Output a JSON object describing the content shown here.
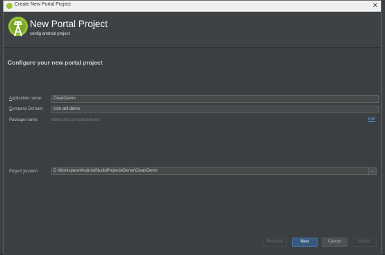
{
  "window": {
    "title": "Create New Portal Project",
    "close_glyph": "✕"
  },
  "header": {
    "title": "New Portal Project",
    "subtitle": "config android project",
    "logo_icon": "android-studio-icon"
  },
  "section": {
    "title": "Configure your new portal project"
  },
  "form": {
    "application_name": {
      "label_prefix": "",
      "label_mnemonic": "A",
      "label_rest": "pplication name:",
      "value": "CleanDemo"
    },
    "company_domain": {
      "label_prefix": "",
      "label_mnemonic": "C",
      "label_rest": "ompany Domain:",
      "value": "com.ant.demo"
    },
    "package_name": {
      "label": "Package name:",
      "value": "demo.ant.com.cleandemo",
      "edit_label": "Edit"
    },
    "project_location": {
      "label_prefix": "Project ",
      "label_mnemonic": "l",
      "label_rest": "ocation:",
      "value": "D:\\Workspace\\AndroidStudioProjects\\Demo\\CleanDemo",
      "browse_label": "..."
    }
  },
  "buttons": {
    "previous": "Previous",
    "next": "Next",
    "cancel": "Cancel",
    "finish": "Finish"
  },
  "colors": {
    "dialog_bg": "#3c3f41",
    "header_bg": "#3f4244",
    "primary_button": "#365880",
    "link": "#589df6",
    "android_green": "#9ac53a"
  }
}
